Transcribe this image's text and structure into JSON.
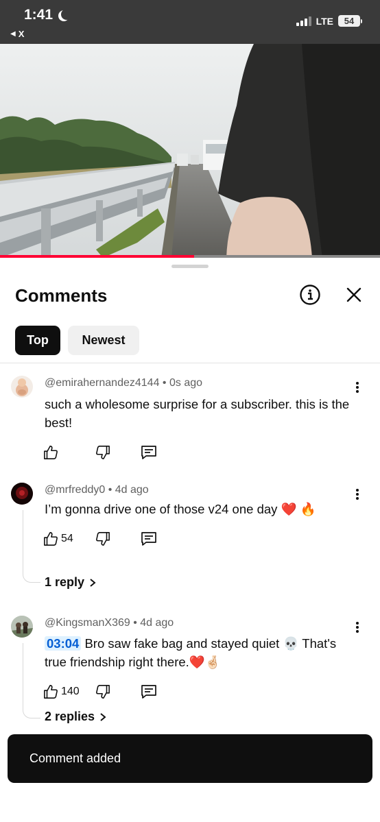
{
  "status_bar": {
    "time": "1:41",
    "back_app": "X",
    "network": "LTE",
    "battery": "54"
  },
  "video": {
    "progress_fraction": 0.51
  },
  "sheet": {
    "title": "Comments",
    "filters": [
      {
        "label": "Top",
        "selected": true
      },
      {
        "label": "Newest",
        "selected": false
      }
    ]
  },
  "comments": [
    {
      "author": "@emirahernandez4144",
      "time": "0s ago",
      "text": "such a wholesome surprise for a subscriber. this is the best!",
      "likes": "",
      "replies": ""
    },
    {
      "author": "@mrfreddy0",
      "time": "4d ago",
      "text": "I’m gonna drive one of those v24 one day ❤️ 🔥",
      "likes": "54",
      "replies": "1 reply"
    },
    {
      "author": "@KingsmanX369",
      "time": "4d ago",
      "timestamp": "03:04",
      "text": " Bro saw  fake bag and stayed quiet 💀 That's true friendship right there.❤️🤞🏻",
      "likes": "140",
      "replies": "2 replies"
    }
  ],
  "toast": {
    "message": "Comment added"
  },
  "colors": {
    "accent_red": "#ff0033",
    "timestamp_link": "#065fd4"
  }
}
